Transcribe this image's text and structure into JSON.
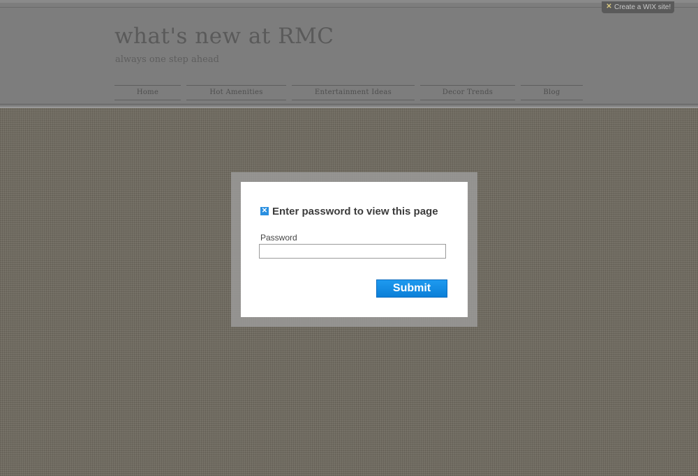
{
  "wix_badge": {
    "label": "Create a WIX site!",
    "icon": "wix-icon"
  },
  "site": {
    "title": "what's new at RMC",
    "tagline": "always one step ahead"
  },
  "nav": {
    "items": [
      {
        "label": "Home"
      },
      {
        "label": "Hot Amenities"
      },
      {
        "label": "Entertainment Ideas"
      },
      {
        "label": "Decor Trends"
      },
      {
        "label": "Blog"
      }
    ]
  },
  "dialog": {
    "icon": "wix-icon",
    "title": "Enter password to view this page",
    "password_label": "Password",
    "password_value": "",
    "submit_label": "Submit"
  },
  "colors": {
    "background": "#6e695e",
    "header": "#7d7d7d",
    "submit_button": "#1e9af0",
    "dialog_background": "#ffffff"
  }
}
